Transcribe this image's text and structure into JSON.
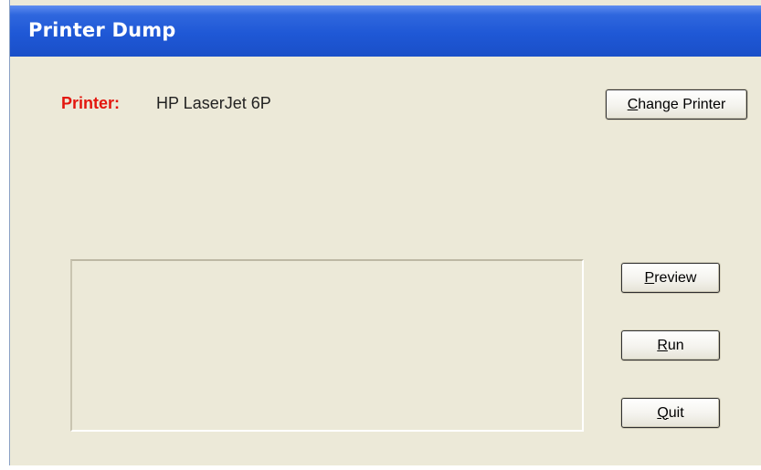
{
  "window": {
    "title": "Printer Dump"
  },
  "printer": {
    "label": "Printer:",
    "name": "HP LaserJet 6P"
  },
  "buttons": {
    "change_printer": {
      "prefix": "",
      "accel": "C",
      "rest": "hange Printer"
    },
    "preview": {
      "prefix": "",
      "accel": "P",
      "rest": "review"
    },
    "run": {
      "prefix": "",
      "accel": "R",
      "rest": "un"
    },
    "quit": {
      "prefix": "",
      "accel": "Q",
      "rest": "uit"
    }
  },
  "colors": {
    "titlebar": "#1f58d6",
    "printer_label": "#e3160e",
    "window_bg": "#ece9d8"
  }
}
